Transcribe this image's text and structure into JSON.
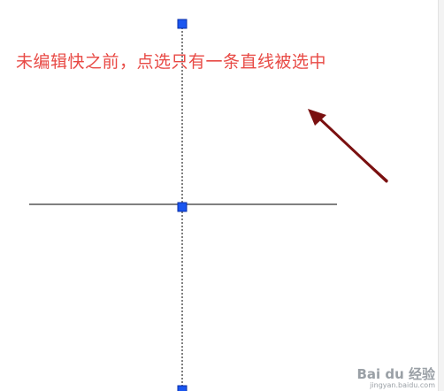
{
  "annotation": {
    "text": "未编辑快之前，点选只有一条直线被选中",
    "color": "#e84a45"
  },
  "canvas": {
    "line_color": "#000000",
    "grip_color": "#1a56f0",
    "grip_border": "#0a2fa8",
    "arrow_color": "#7a1010"
  },
  "watermark": {
    "logo": "Bai du 经验",
    "url": "jingyan.baidu.com"
  },
  "icons": {
    "arrow": "annotation-arrow-icon",
    "grip": "grip-square-icon"
  }
}
